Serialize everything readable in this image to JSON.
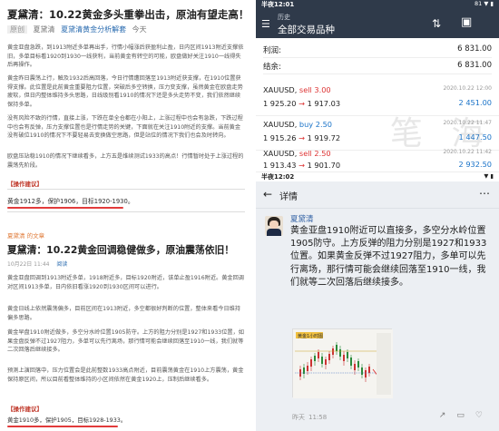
{
  "article1": {
    "title": "夏黛清：10.22黄金多头重拳出击，原油有望走高！",
    "tag": "原创",
    "author": "夏黛清",
    "column": "夏黛清黄金分析解套",
    "follow": "今天",
    "paragraphs": [
      "黄金亚盘急跌，到1913附近多单再出手，行情小幅涨后获盈利止盈，日内区间1913附近支撑依旧，多单目标看1920到1930一线获利，当前黄金有转空的可能，欧盘做好关注1910一线得失后再操作。",
      "黄金昨日震荡上行，触及1932后高回落，今日行情遭回落至1913附近获支撑，在1910位置获得支撑。此位置是此前黄金重要阻力位置，突破后多空转换，压力变支撑，虽然黄金在欧盘走势疲软，但日内整体维持多头思路，日线级别看1910的情况下还是多头走势不变，我们依然继续保持多单。",
      "没有风险不致的行情，直接上涨，下跌在单全仓都在小阳上，上涨过程中也会有急跌，下跌过程中也会有反弹，压力支撑位置也是行情走势的关键，下面就在关注1910附近的支撑。当前黄金没有破位1910的情况下不要轻易去变换做空思路，但是站位的情况下我们也会及时转向。",
      "欧盘压站稳1910的情况下继续看多，上方五是维续测试1933的高点！行情暂时处于上涨过程的震荡先阶段。"
    ],
    "section_label": "【操作建议】",
    "advice": "黄金1912多，保护1906，目标1920-1930。"
  },
  "article2": {
    "author_line": "夏黛清 的文章",
    "title": "夏黛清：10.22黄金回调稳健做多，原油震荡依旧！",
    "meta_date": "10月22日 11:44",
    "meta_reads": "阅读",
    "paragraphs": [
      "黄金亚盘回调到1913附近多单，1918附近多，目标1920附近，该单止盈1916附近。黄金回调对区间1913多单，日内依旧看涨1920到1930区间可以进行。",
      "黄金日线上依然震荡偏多，目前区间在1913附近，多空都很好判断的位置，整体来看今日维持偏多思路。",
      "黄金早盘1910附近做多，多空分水岭位置1905防守。上方的阻力分别是1927和1933位置，如果金盘反弹不过1927阻力，多单可以先行离场，那行情可能会继续回落至1910一线，我们就等二次回落后继续接多。",
      "预测上演回落中，压力位置会是此前整数1933高点附近，目前震荡黄金在1910上方震荡，黄金保持原区间，所以目前看整体维持的小区间依然在黄金1920上，压制后继续看多。"
    ],
    "section_label": "【操作建议】",
    "advice": "黄金1910多，保护1905，目标1928-1933。"
  },
  "trading_app": {
    "status_time": "半夜12:01",
    "status_right": "81 ▼ ▮",
    "header_sub": "历史",
    "header_title": "全部交易品种",
    "profit_label": "利润:",
    "profit_value": "6 831.00",
    "balance_label": "结余:",
    "balance_value": "6 831.00",
    "trades": [
      {
        "symbol": "XAUUSD,",
        "side": "sell 3.00",
        "side_type": "sell",
        "open": "1 925.20",
        "close": "1 917.03",
        "date": "2020.10.22 12:00",
        "pnl": "2 451.00"
      },
      {
        "symbol": "XAUUSD,",
        "side": "buy 2.50",
        "side_type": "buy",
        "open": "1 915.26",
        "close": "1 919.72",
        "date": "2020.10.22 11:47",
        "pnl": "1 447.50"
      },
      {
        "symbol": "XAUUSD,",
        "side": "sell 2.50",
        "side_type": "sell",
        "open": "1 913.43",
        "close": "1 901.70",
        "date": "2020.10.22 11:42",
        "pnl": "2 932.50"
      }
    ]
  },
  "chat": {
    "status_time": "半夜12:02",
    "status_right": "▼ ▮",
    "title": "详情",
    "sender": "夏黛清",
    "message": "黄金亚盘1910附近可以直接多，多空分水岭位置1905防守。上方反弹的阻力分别是1927和1933位置。如果黄金反弹不过1927阻力，多单可以先行离场，那行情可能会继续回落至1910一线，我们就等二次回落后继续接多。",
    "timestamp": "昨天",
    "time": "11:58",
    "chart_caption": "黄金1小时图"
  },
  "watermark": "笔 海",
  "colors": {
    "accent_red": "#e23b3b",
    "sell": "#d33333",
    "buy": "#1a73c8",
    "header_dark": "#2f3a4a"
  }
}
